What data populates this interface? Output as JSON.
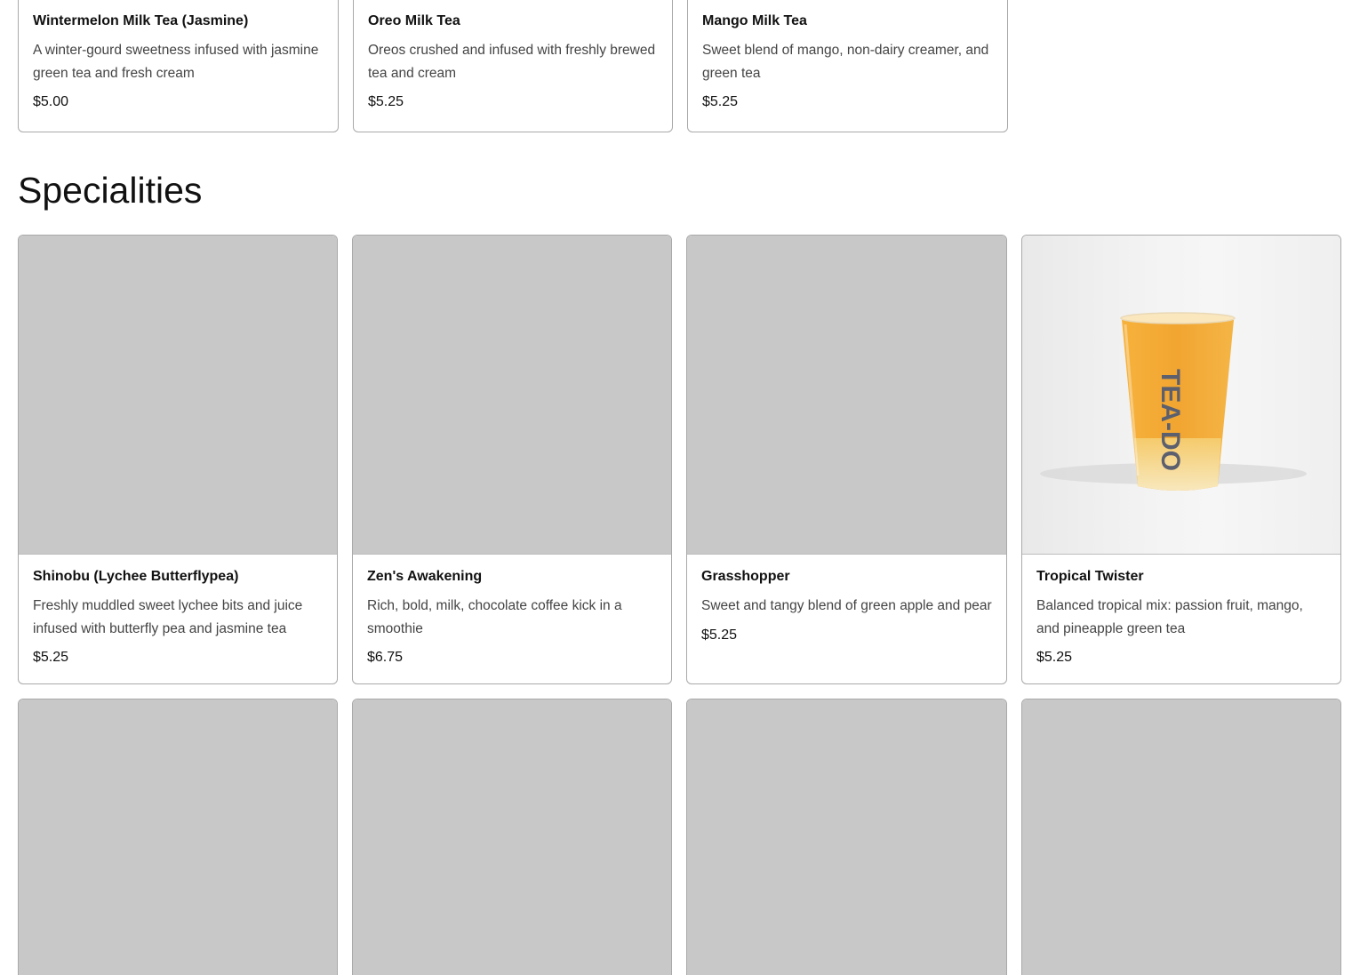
{
  "previous_section": {
    "items": [
      {
        "name": "Wintermelon Milk Tea (Jasmine)",
        "description": "A winter-gourd sweetness infused with jasmine green tea and fresh cream",
        "price": "$5.00"
      },
      {
        "name": "Oreo Milk Tea",
        "description": "Oreos crushed and infused with freshly brewed tea and cream",
        "price": "$5.25"
      },
      {
        "name": "Mango Milk Tea",
        "description": "Sweet blend of mango, non-dairy creamer, and green tea",
        "price": "$5.25"
      }
    ]
  },
  "specialities": {
    "title": "Specialities",
    "items": [
      {
        "name": "Shinobu (Lychee Butterflypea)",
        "description": "Freshly muddled sweet lychee bits and juice infused with butterfly pea and jasmine tea",
        "price": "$5.25",
        "image": "placeholder"
      },
      {
        "name": "Zen's Awakening",
        "description": "Rich, bold, milk, chocolate coffee kick in a smoothie",
        "price": "$6.75",
        "image": "placeholder"
      },
      {
        "name": "Grasshopper",
        "description": "Sweet and tangy blend of green apple and pear",
        "price": "$5.25",
        "image": "placeholder"
      },
      {
        "name": "Tropical Twister",
        "description": "Balanced tropical mix: passion fruit, mango, and pineapple green tea",
        "price": "$5.25",
        "image": "drink-cup-photo",
        "cup_logo_text": "TEA-DO"
      }
    ],
    "next_row_images": [
      "placeholder",
      "placeholder",
      "placeholder",
      "placeholder"
    ]
  },
  "colors": {
    "placeholder_gray": "#c8c8c8",
    "card_border": "#a9a9a9",
    "drink_orange": "#f2a531"
  }
}
